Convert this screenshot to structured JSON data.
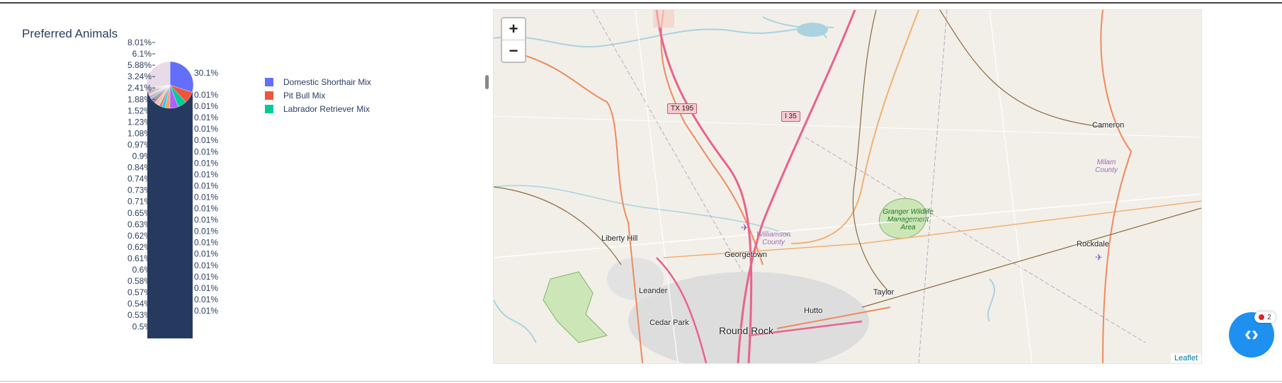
{
  "chart_data": {
    "type": "pie",
    "title": "Preferred Animals",
    "legend_position": "right",
    "legend": [
      {
        "label": "Domestic Shorthair Mix",
        "color": "#636efa"
      },
      {
        "label": "Pit Bull Mix",
        "color": "#ef553b"
      },
      {
        "label": "Labrador Retriever Mix",
        "color": "#00cc96"
      }
    ],
    "slice_colors": [
      "#636efa",
      "#ef553b",
      "#00cc96",
      "#ab63fa",
      "#ffa15a",
      "#19d3f3",
      "#ff6692",
      "#b6e880",
      "#ff97ff",
      "#fecb52"
    ],
    "slice_values": [
      30.1,
      8.01,
      6.1,
      5.88,
      3.24,
      2.41,
      1.88,
      1.52,
      1.23,
      1.08,
      0.97,
      0.9,
      0.84,
      0.74,
      0.73,
      0.71,
      0.65,
      0.63,
      0.62,
      0.62,
      0.61,
      0.6,
      0.58,
      0.57,
      0.54,
      0.53,
      0.5
    ],
    "left_labels": [
      "8.01%",
      "6.1%",
      "5.88%",
      "3.24%",
      "2.41%",
      "1.88%",
      "1.52%",
      "1.23%",
      "1.08%",
      "0.97%",
      "0.9%",
      "0.84%",
      "0.74%",
      "0.73%",
      "0.71%",
      "0.65%",
      "0.63%",
      "0.62%",
      "0.62%",
      "0.61%",
      "0.6%",
      "0.58%",
      "0.57%",
      "0.54%",
      "0.53%",
      "0.5%"
    ],
    "right_labels": [
      "30.1%",
      "0.01%",
      "0.01%",
      "0.01%",
      "0.01%",
      "0.01%",
      "0.01%",
      "0.01%",
      "0.01%",
      "0.01%",
      "0.01%",
      "0.01%",
      "0.01%",
      "0.01%",
      "0.01%",
      "0.01%",
      "0.01%",
      "0.01%",
      "0.01%",
      "0.01%",
      "0.01%"
    ],
    "small_slice_value": 0.01
  },
  "map": {
    "zoom_in": "+",
    "zoom_out": "−",
    "attribution": "Leaflet",
    "shields": [
      "TX 195",
      "I 35"
    ],
    "towns": [
      "Cameron",
      "Liberty Hill",
      "Georgetown",
      "Leander",
      "Taylor",
      "Hutto",
      "Cedar Park",
      "Round Rock",
      "Rockdale"
    ],
    "counties": [
      "Williamson County",
      "Milam County"
    ],
    "park": "Granger Wildlife Management Area",
    "colors": {
      "land": "#f2efe9",
      "water": "#aad3df",
      "highway": "#e8638b",
      "primary": "#f08a5d",
      "park": "#cde6b8"
    }
  },
  "fab": {
    "glyph": "‹›",
    "badge_count": "2"
  }
}
